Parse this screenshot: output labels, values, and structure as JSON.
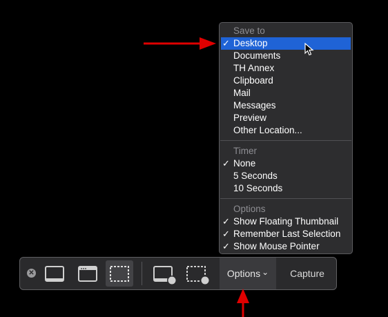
{
  "menu": {
    "save_header": "Save to",
    "save_items": [
      {
        "label": "Desktop",
        "checked": "✓"
      },
      {
        "label": "Documents",
        "checked": ""
      },
      {
        "label": "TH Annex",
        "checked": ""
      },
      {
        "label": "Clipboard",
        "checked": ""
      },
      {
        "label": "Mail",
        "checked": ""
      },
      {
        "label": "Messages",
        "checked": ""
      },
      {
        "label": "Preview",
        "checked": ""
      },
      {
        "label": "Other Location...",
        "checked": ""
      }
    ],
    "timer_header": "Timer",
    "timer_items": [
      {
        "label": "None",
        "checked": "✓"
      },
      {
        "label": "5 Seconds",
        "checked": ""
      },
      {
        "label": "10 Seconds",
        "checked": ""
      }
    ],
    "options_header": "Options",
    "options_items": [
      {
        "label": "Show Floating Thumbnail",
        "checked": "✓"
      },
      {
        "label": "Remember Last Selection",
        "checked": "✓"
      },
      {
        "label": "Show Mouse Pointer",
        "checked": "✓"
      }
    ],
    "highlight_color": "#1f63d6"
  },
  "toolbar": {
    "close_glyph": "✕",
    "options_label": "Options",
    "options_chevron": "⌄",
    "capture_label": "Capture",
    "icons": [
      "close-icon",
      "capture-entire-screen-icon",
      "capture-window-icon",
      "capture-selection-icon",
      "record-entire-screen-icon",
      "record-selection-icon"
    ]
  },
  "annotations": {
    "arrow_color": "#e00000"
  }
}
